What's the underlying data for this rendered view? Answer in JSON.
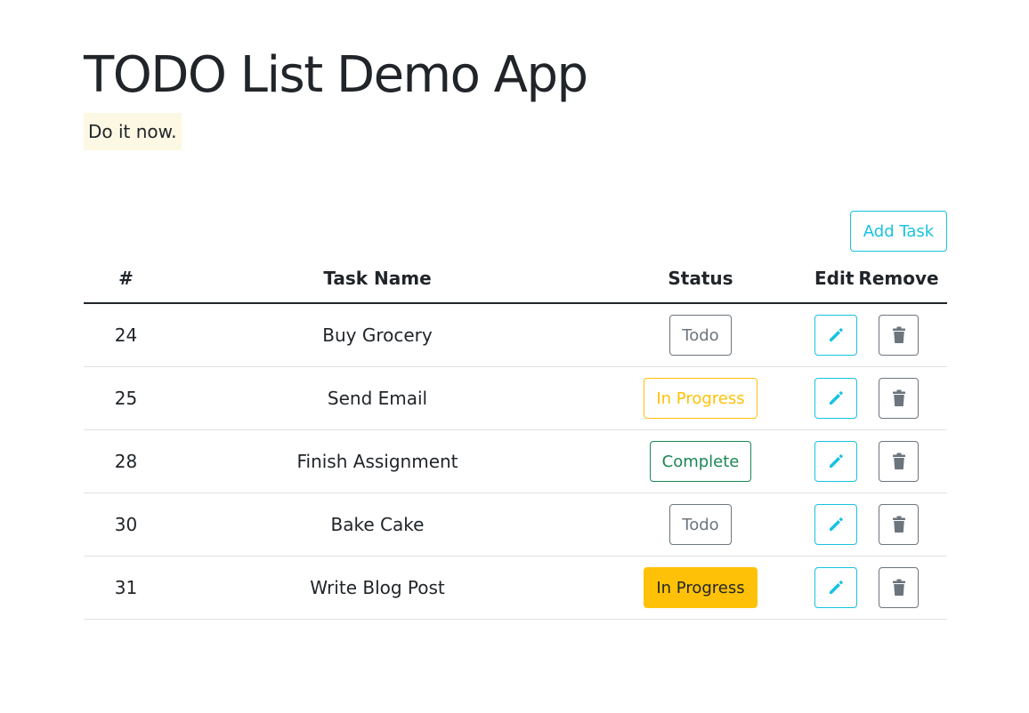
{
  "header": {
    "title": "TODO List Demo App",
    "tagline": "Do it now."
  },
  "toolbar": {
    "add_task_label": "Add Task"
  },
  "table": {
    "columns": [
      "#",
      "Task Name",
      "Status",
      "Edit",
      "Remove"
    ],
    "rows": [
      {
        "id": "24",
        "name": "Buy Grocery",
        "status": "Todo"
      },
      {
        "id": "25",
        "name": "Send Email",
        "status": "In Progress"
      },
      {
        "id": "28",
        "name": "Finish Assignment",
        "status": "Complete"
      },
      {
        "id": "30",
        "name": "Bake Cake",
        "status": "Todo"
      },
      {
        "id": "31",
        "name": "Write Blog Post",
        "status": "In Progress"
      }
    ]
  },
  "icons": {
    "edit": "pencil-icon",
    "remove": "trash-icon"
  },
  "colors": {
    "info": "#17c2e1",
    "warning": "#ffc107",
    "success": "#198754",
    "secondary": "#6c757d",
    "tagline_bg": "#fcf8e3"
  }
}
